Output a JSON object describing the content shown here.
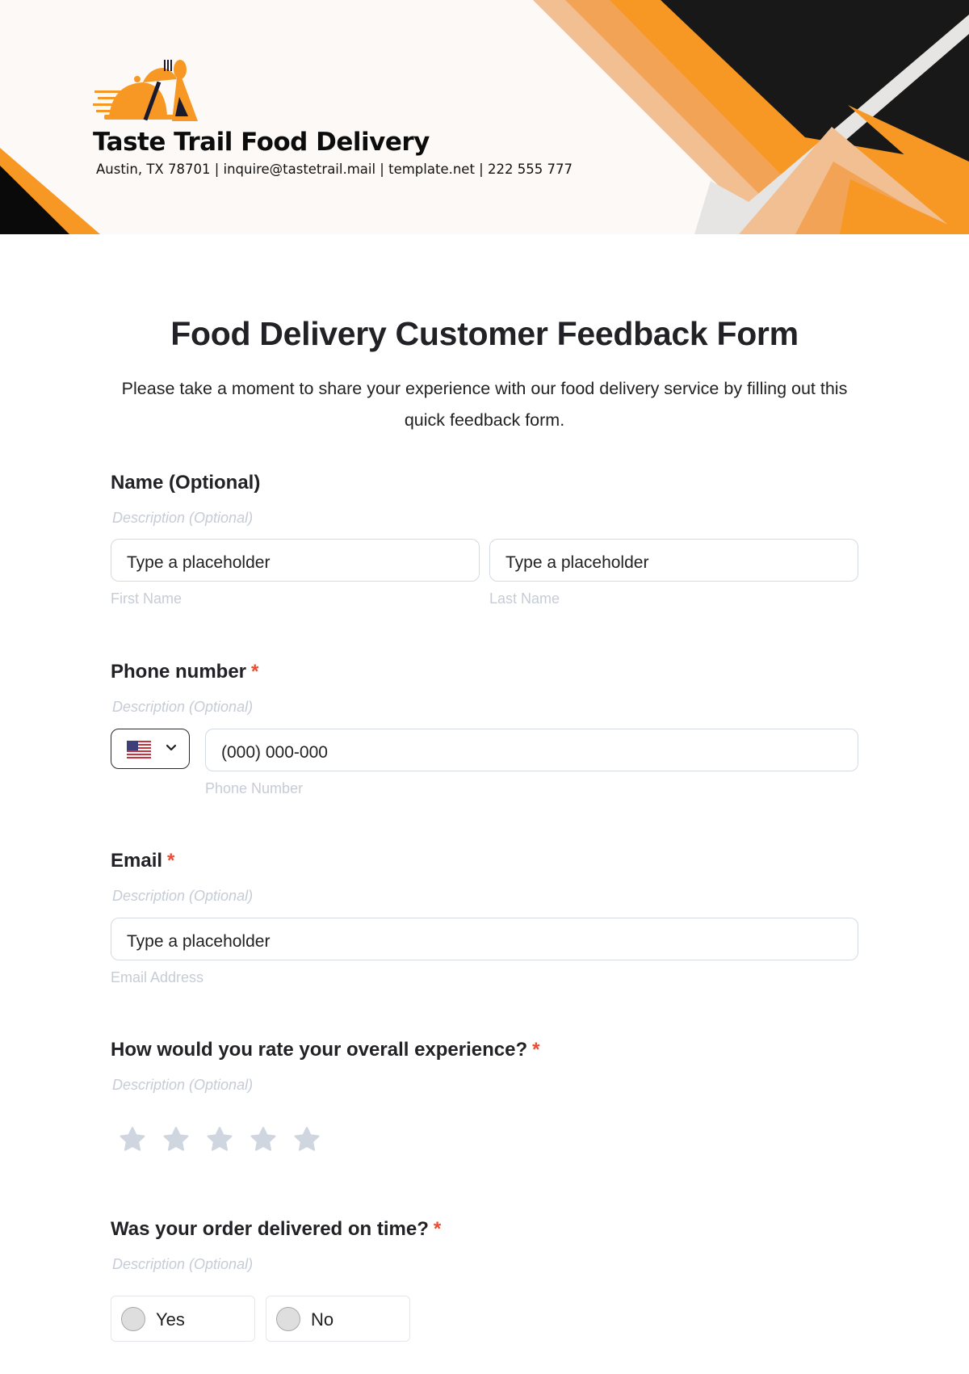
{
  "header": {
    "company_name": "Taste Trail Food Delivery",
    "company_info": "Austin, TX 78701 | inquire@tastetrail.mail | template.net | 222 555 777",
    "logo_icon": "food-delivery-cloche-fork-spoon-icon",
    "colors": {
      "background": "#fdf9f6",
      "orange": "#f79824",
      "orange_mid": "#f3a355",
      "peach": "#f2bf93",
      "black": "#181818",
      "grey": "#e6e5e3"
    }
  },
  "form": {
    "title": "Food Delivery Customer Feedback Form",
    "intro": "Please take a moment to share your experience with our food delivery service by filling out this quick feedback form.",
    "required_marker": "*",
    "questions": [
      {
        "label": "Name (Optional)",
        "description": "Description (Optional)",
        "required": false,
        "fields": [
          {
            "placeholder": "Type a placeholder",
            "sublabel": "First Name"
          },
          {
            "placeholder": "Type a placeholder",
            "sublabel": "Last Name"
          }
        ]
      },
      {
        "label": "Phone number",
        "description": "Description (Optional)",
        "required": true,
        "country_flag": "us-flag-icon",
        "placeholder": "(000) 000-000",
        "sublabel": "Phone Number"
      },
      {
        "label": "Email",
        "description": "Description (Optional)",
        "required": true,
        "placeholder": "Type a placeholder",
        "sublabel": "Email Address"
      },
      {
        "label": "How would you rate your overall experience?",
        "description": "Description (Optional)",
        "required": true,
        "rating_max": 5,
        "rating_value": 0,
        "star_color": "#cfd6df"
      },
      {
        "label": "Was your order delivered on time?",
        "description": "Description (Optional)",
        "required": true,
        "options": [
          "Yes",
          "No"
        ],
        "selected": null
      }
    ]
  }
}
